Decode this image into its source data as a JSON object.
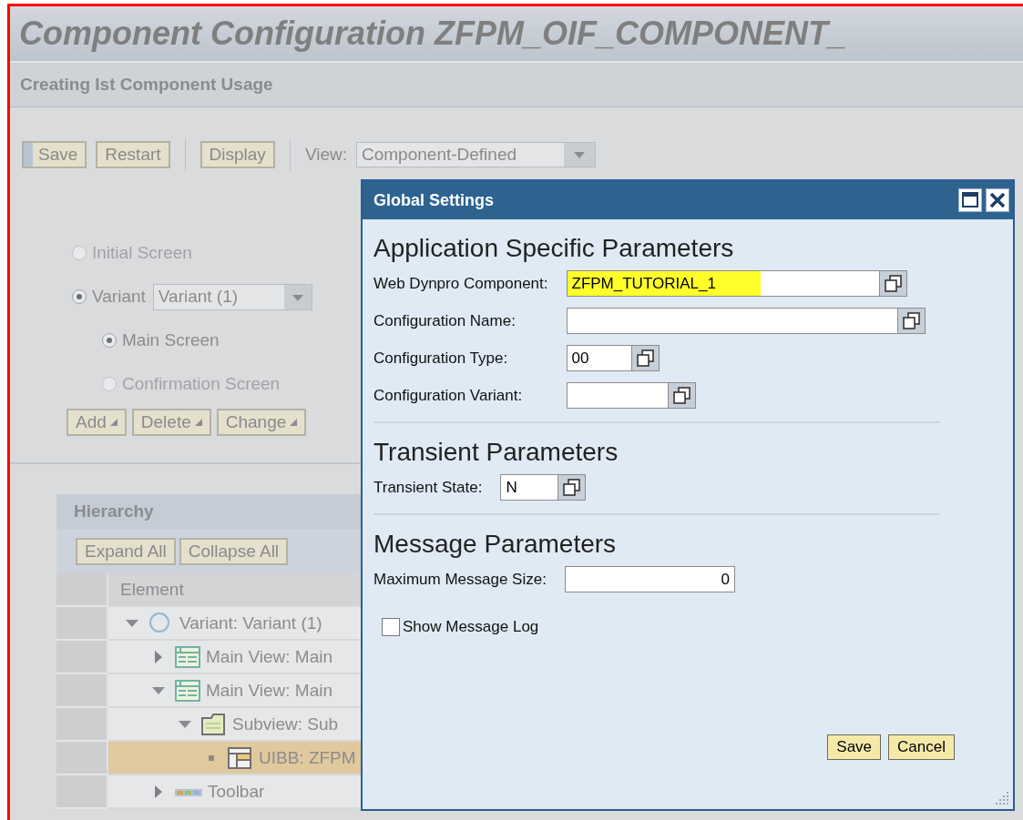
{
  "header": {
    "title": "Component Configuration ZFPM_OIF_COMPONENT_",
    "subtitle": "Creating Ist Component Usage"
  },
  "toolbar": {
    "button_groups": [
      [
        {
          "label": "Save",
          "focused": true
        },
        {
          "label": "Restart",
          "focused": false
        }
      ],
      [
        {
          "label": "Display",
          "focused": false
        }
      ]
    ],
    "view_label": "View:",
    "view_value": "Component-Defined"
  },
  "screens": [
    {
      "label": "Initial Screen",
      "selected": false,
      "disabled": true
    },
    {
      "label": "Variant",
      "selected": true,
      "disabled": false,
      "dropdown": "Variant (1)",
      "children": [
        {
          "label": "Main Screen",
          "selected": true,
          "disabled": false
        },
        {
          "label": "Confirmation Screen",
          "selected": false,
          "disabled": true
        }
      ]
    }
  ],
  "screen_actions": [
    "Add",
    "Delete",
    "Change"
  ],
  "hierarchy": {
    "title": "Hierarchy",
    "buttons": [
      "Expand All",
      "Collapse All"
    ],
    "column": "Element",
    "tree": [
      {
        "label": "Variant: Variant (1)",
        "kind": "variant",
        "leaf": false,
        "expanded": true,
        "selected": false,
        "children": [
          {
            "label": "Main View: Main",
            "kind": "view",
            "leaf": false,
            "expanded": false,
            "selected": false
          },
          {
            "label": "Main View: Main",
            "kind": "view",
            "leaf": false,
            "expanded": true,
            "selected": false,
            "children": [
              {
                "label": "Subview: Sub",
                "kind": "subview",
                "leaf": false,
                "expanded": true,
                "selected": false,
                "children": [
                  {
                    "label": "UIBB: ZFPM",
                    "kind": "uibb",
                    "leaf": true,
                    "selected": true
                  }
                ]
              }
            ]
          },
          {
            "label": "Toolbar",
            "kind": "toolbar",
            "leaf": false,
            "expanded": false,
            "selected": false
          }
        ]
      }
    ]
  },
  "dialog": {
    "title": "Global Settings",
    "sections": [
      {
        "title": "Application Specific Parameters",
        "fields": [
          {
            "label": "Web Dynpro Component:",
            "value": "ZFPM_TUTORIAL_1",
            "value_help": true,
            "highlighted": true,
            "numeric": false
          },
          {
            "label": "Configuration Name:",
            "value_help": true,
            "highlighted": false,
            "numeric": false
          },
          {
            "label": "Configuration Type:",
            "value": "00",
            "value_help": true,
            "highlighted": false,
            "numeric": false
          },
          {
            "label": "Configuration Variant:",
            "value_help": true,
            "highlighted": false,
            "numeric": false
          }
        ]
      },
      {
        "title": "Transient Parameters",
        "fields": [
          {
            "label": "Transient State:",
            "value": "N",
            "value_help": true,
            "highlighted": false,
            "numeric": false
          }
        ]
      },
      {
        "title": "Message Parameters",
        "fields": [
          {
            "label": "Maximum Message Size:",
            "value": "0",
            "value_help": false,
            "highlighted": false,
            "numeric": true
          }
        ]
      }
    ],
    "checkbox": {
      "label": "Show Message Log",
      "checked": false
    },
    "buttons": [
      "Save",
      "Cancel"
    ]
  }
}
